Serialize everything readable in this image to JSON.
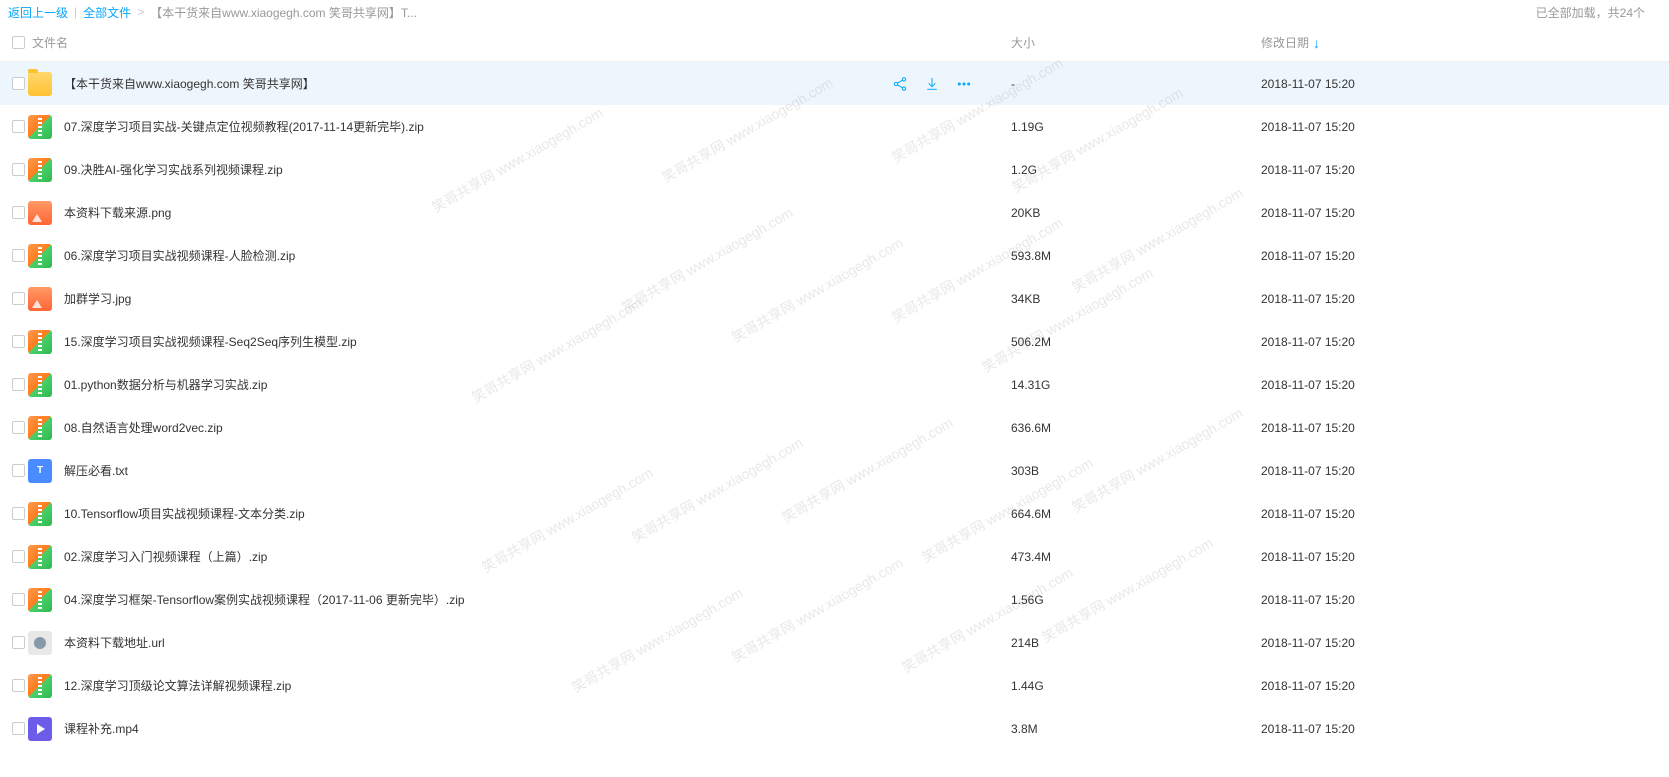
{
  "breadcrumb": {
    "back": "返回上一级",
    "all_files": "全部文件",
    "current": "【本干货来自www.xiaogegh.com 笑哥共享网】T..."
  },
  "status": "已全部加载，共24个",
  "columns": {
    "name": "文件名",
    "size": "大小",
    "date": "修改日期"
  },
  "watermark_text": "笑哥共享网 www.xiaogegh.com",
  "files": [
    {
      "type": "folder",
      "name": "【本干货来自www.xiaogegh.com 笑哥共享网】",
      "size": "-",
      "date": "2018-11-07 15:20",
      "selected": true
    },
    {
      "type": "zip",
      "name": "07.深度学习项目实战-关键点定位视频教程(2017-11-14更新完毕).zip",
      "size": "1.19G",
      "date": "2018-11-07 15:20"
    },
    {
      "type": "zip",
      "name": "09.决胜AI-强化学习实战系列视频课程.zip",
      "size": "1.2G",
      "date": "2018-11-07 15:20"
    },
    {
      "type": "img",
      "name": "本资料下载来源.png",
      "size": "20KB",
      "date": "2018-11-07 15:20"
    },
    {
      "type": "zip",
      "name": "06.深度学习项目实战视频课程-人脸检测.zip",
      "size": "593.8M",
      "date": "2018-11-07 15:20"
    },
    {
      "type": "img",
      "name": "加群学习.jpg",
      "size": "34KB",
      "date": "2018-11-07 15:20"
    },
    {
      "type": "zip",
      "name": "15.深度学习项目实战视频课程-Seq2Seq序列生模型.zip",
      "size": "506.2M",
      "date": "2018-11-07 15:20"
    },
    {
      "type": "zip",
      "name": "01.python数据分析与机器学习实战.zip",
      "size": "14.31G",
      "date": "2018-11-07 15:20"
    },
    {
      "type": "zip",
      "name": "08.自然语言处理word2vec.zip",
      "size": "636.6M",
      "date": "2018-11-07 15:20"
    },
    {
      "type": "txt",
      "name": "解压必看.txt",
      "size": "303B",
      "date": "2018-11-07 15:20"
    },
    {
      "type": "zip",
      "name": "10.Tensorflow项目实战视频课程-文本分类.zip",
      "size": "664.6M",
      "date": "2018-11-07 15:20"
    },
    {
      "type": "zip",
      "name": "02.深度学习入门视频课程（上篇）.zip",
      "size": "473.4M",
      "date": "2018-11-07 15:20"
    },
    {
      "type": "zip",
      "name": "04.深度学习框架-Tensorflow案例实战视频课程（2017-11-06 更新完毕）.zip",
      "size": "1.56G",
      "date": "2018-11-07 15:20"
    },
    {
      "type": "url",
      "name": "本资料下载地址.url",
      "size": "214B",
      "date": "2018-11-07 15:20"
    },
    {
      "type": "zip",
      "name": "12.深度学习顶级论文算法详解视频课程.zip",
      "size": "1.44G",
      "date": "2018-11-07 15:20"
    },
    {
      "type": "mp4",
      "name": "课程补充.mp4",
      "size": "3.8M",
      "date": "2018-11-07 15:20"
    }
  ]
}
